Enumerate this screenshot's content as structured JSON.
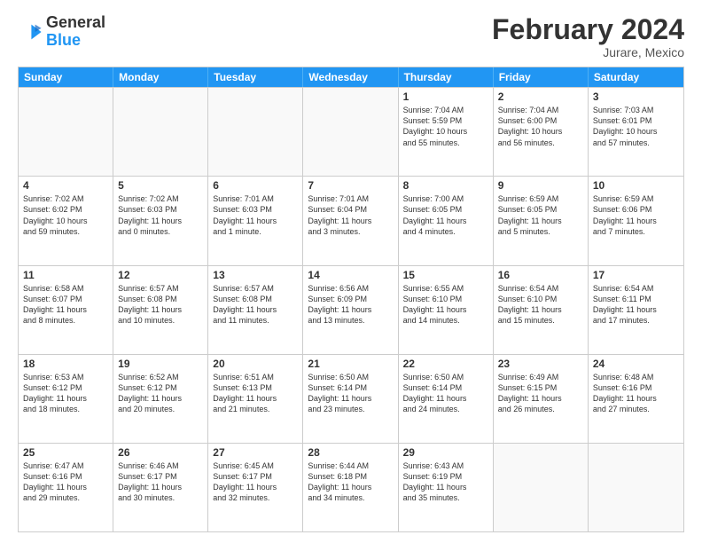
{
  "logo": {
    "line1": "General",
    "line2": "Blue"
  },
  "title": "February 2024",
  "location": "Jurare, Mexico",
  "header_days": [
    "Sunday",
    "Monday",
    "Tuesday",
    "Wednesday",
    "Thursday",
    "Friday",
    "Saturday"
  ],
  "weeks": [
    [
      {
        "day": "",
        "info": ""
      },
      {
        "day": "",
        "info": ""
      },
      {
        "day": "",
        "info": ""
      },
      {
        "day": "",
        "info": ""
      },
      {
        "day": "1",
        "info": "Sunrise: 7:04 AM\nSunset: 5:59 PM\nDaylight: 10 hours\nand 55 minutes."
      },
      {
        "day": "2",
        "info": "Sunrise: 7:04 AM\nSunset: 6:00 PM\nDaylight: 10 hours\nand 56 minutes."
      },
      {
        "day": "3",
        "info": "Sunrise: 7:03 AM\nSunset: 6:01 PM\nDaylight: 10 hours\nand 57 minutes."
      }
    ],
    [
      {
        "day": "4",
        "info": "Sunrise: 7:02 AM\nSunset: 6:02 PM\nDaylight: 10 hours\nand 59 minutes."
      },
      {
        "day": "5",
        "info": "Sunrise: 7:02 AM\nSunset: 6:03 PM\nDaylight: 11 hours\nand 0 minutes."
      },
      {
        "day": "6",
        "info": "Sunrise: 7:01 AM\nSunset: 6:03 PM\nDaylight: 11 hours\nand 1 minute."
      },
      {
        "day": "7",
        "info": "Sunrise: 7:01 AM\nSunset: 6:04 PM\nDaylight: 11 hours\nand 3 minutes."
      },
      {
        "day": "8",
        "info": "Sunrise: 7:00 AM\nSunset: 6:05 PM\nDaylight: 11 hours\nand 4 minutes."
      },
      {
        "day": "9",
        "info": "Sunrise: 6:59 AM\nSunset: 6:05 PM\nDaylight: 11 hours\nand 5 minutes."
      },
      {
        "day": "10",
        "info": "Sunrise: 6:59 AM\nSunset: 6:06 PM\nDaylight: 11 hours\nand 7 minutes."
      }
    ],
    [
      {
        "day": "11",
        "info": "Sunrise: 6:58 AM\nSunset: 6:07 PM\nDaylight: 11 hours\nand 8 minutes."
      },
      {
        "day": "12",
        "info": "Sunrise: 6:57 AM\nSunset: 6:08 PM\nDaylight: 11 hours\nand 10 minutes."
      },
      {
        "day": "13",
        "info": "Sunrise: 6:57 AM\nSunset: 6:08 PM\nDaylight: 11 hours\nand 11 minutes."
      },
      {
        "day": "14",
        "info": "Sunrise: 6:56 AM\nSunset: 6:09 PM\nDaylight: 11 hours\nand 13 minutes."
      },
      {
        "day": "15",
        "info": "Sunrise: 6:55 AM\nSunset: 6:10 PM\nDaylight: 11 hours\nand 14 minutes."
      },
      {
        "day": "16",
        "info": "Sunrise: 6:54 AM\nSunset: 6:10 PM\nDaylight: 11 hours\nand 15 minutes."
      },
      {
        "day": "17",
        "info": "Sunrise: 6:54 AM\nSunset: 6:11 PM\nDaylight: 11 hours\nand 17 minutes."
      }
    ],
    [
      {
        "day": "18",
        "info": "Sunrise: 6:53 AM\nSunset: 6:12 PM\nDaylight: 11 hours\nand 18 minutes."
      },
      {
        "day": "19",
        "info": "Sunrise: 6:52 AM\nSunset: 6:12 PM\nDaylight: 11 hours\nand 20 minutes."
      },
      {
        "day": "20",
        "info": "Sunrise: 6:51 AM\nSunset: 6:13 PM\nDaylight: 11 hours\nand 21 minutes."
      },
      {
        "day": "21",
        "info": "Sunrise: 6:50 AM\nSunset: 6:14 PM\nDaylight: 11 hours\nand 23 minutes."
      },
      {
        "day": "22",
        "info": "Sunrise: 6:50 AM\nSunset: 6:14 PM\nDaylight: 11 hours\nand 24 minutes."
      },
      {
        "day": "23",
        "info": "Sunrise: 6:49 AM\nSunset: 6:15 PM\nDaylight: 11 hours\nand 26 minutes."
      },
      {
        "day": "24",
        "info": "Sunrise: 6:48 AM\nSunset: 6:16 PM\nDaylight: 11 hours\nand 27 minutes."
      }
    ],
    [
      {
        "day": "25",
        "info": "Sunrise: 6:47 AM\nSunset: 6:16 PM\nDaylight: 11 hours\nand 29 minutes."
      },
      {
        "day": "26",
        "info": "Sunrise: 6:46 AM\nSunset: 6:17 PM\nDaylight: 11 hours\nand 30 minutes."
      },
      {
        "day": "27",
        "info": "Sunrise: 6:45 AM\nSunset: 6:17 PM\nDaylight: 11 hours\nand 32 minutes."
      },
      {
        "day": "28",
        "info": "Sunrise: 6:44 AM\nSunset: 6:18 PM\nDaylight: 11 hours\nand 34 minutes."
      },
      {
        "day": "29",
        "info": "Sunrise: 6:43 AM\nSunset: 6:19 PM\nDaylight: 11 hours\nand 35 minutes."
      },
      {
        "day": "",
        "info": ""
      },
      {
        "day": "",
        "info": ""
      }
    ]
  ]
}
